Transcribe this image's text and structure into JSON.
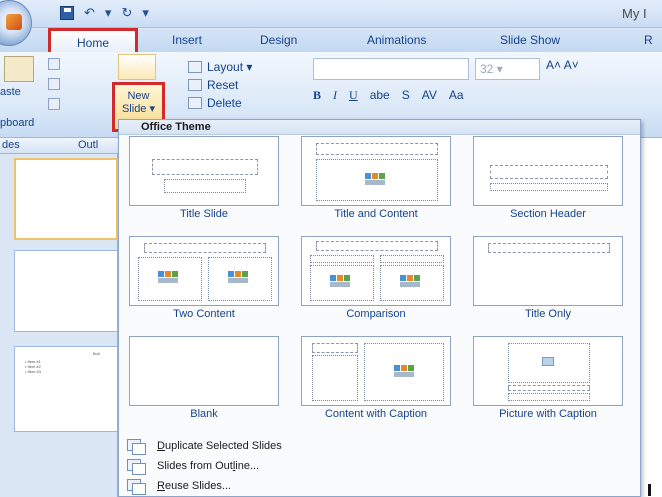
{
  "window": {
    "title_fragment": "My I"
  },
  "tabs": [
    {
      "label": "Home"
    },
    {
      "label": "Insert"
    },
    {
      "label": "Design"
    },
    {
      "label": "Animations"
    },
    {
      "label": "Slide Show"
    },
    {
      "label": "R"
    }
  ],
  "ribbon": {
    "paste_label": "aste",
    "clipboard_label": "pboard",
    "new_slide_line1": "New",
    "new_slide_line2": "Slide ▾",
    "slides_group": [
      {
        "label": "Layout ▾"
      },
      {
        "label": "Reset"
      },
      {
        "label": "Delete"
      }
    ],
    "font_size": "32",
    "bold": "B",
    "italic": "I",
    "underline": "U",
    "strike": "abe",
    "shadow": "S",
    "spacing": "AV",
    "case": "Aa"
  },
  "panel": {
    "tab_slides": "des",
    "tab_outline": "Outl",
    "thumb3_small": "Bull"
  },
  "menu": {
    "header": "Office Theme",
    "layouts": [
      {
        "label": "Title Slide"
      },
      {
        "label": "Title and Content"
      },
      {
        "label": "Section Header"
      },
      {
        "label": "Two Content"
      },
      {
        "label": "Comparison"
      },
      {
        "label": "Title Only"
      },
      {
        "label": "Blank"
      },
      {
        "label": "Content with Caption"
      },
      {
        "label": "Picture with Caption"
      }
    ],
    "actions": [
      {
        "label": "Duplicate Selected Slides",
        "underline": "D",
        "rest": "uplicate Selected Slides"
      },
      {
        "label": "Slides from Outline...",
        "pre": "Slides from Out",
        "underline": "l",
        "rest": "ine..."
      },
      {
        "label": "Reuse Slides...",
        "underline": "R",
        "rest": "euse Slides..."
      }
    ]
  },
  "colors": {
    "highlight_border": "#d22a2a",
    "ribbon_text": "#15428b"
  }
}
